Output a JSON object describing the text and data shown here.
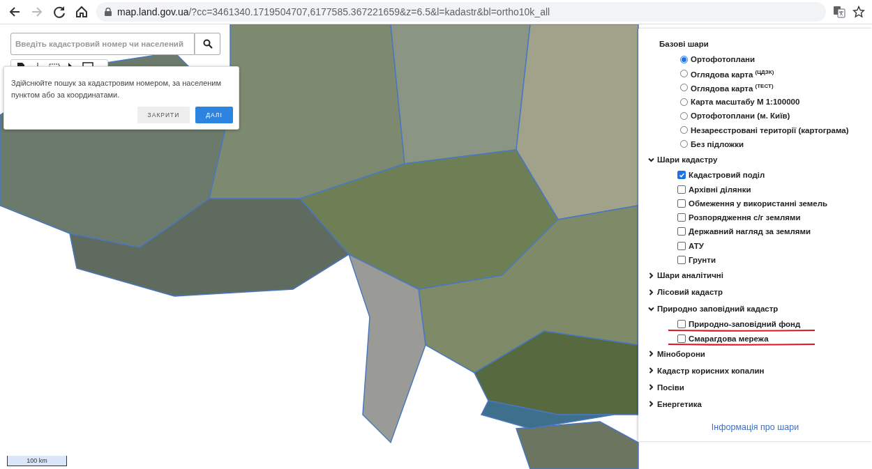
{
  "browser": {
    "url": "map.land.gov.ua/?cc=3461340.1719504707,6177585.367221659&z=6.5&l=kadastr&bl=ortho10k_all",
    "forward_disabled": true
  },
  "map": {
    "scale": "100 km"
  },
  "search": {
    "placeholder": "Введіть кадастровий номер чи населений"
  },
  "hint": {
    "text": "Здійснюйте пошук за кадастровим номером, за населеним пунктом або за координатами.",
    "buttons": [
      {
        "label": "ЗАКРИТИ",
        "kind": "secondary"
      },
      {
        "label": "ДАЛІ",
        "kind": "primary"
      }
    ]
  },
  "layers": {
    "sections": [
      {
        "title": "Базові шари",
        "kind": "base",
        "items": [
          {
            "kind": "radio",
            "label": "Ортофотоплани",
            "selected": true,
            "underlined": false
          },
          {
            "kind": "radio",
            "label": "Оглядова карта $^{(ЦДЗК)}$",
            "selected": false,
            "underlined": false
          },
          {
            "kind": "radio",
            "label": "Оглядова карта $^{(ТЕСТ)}$",
            "selected": false,
            "underlined": false
          },
          {
            "kind": "radio",
            "label": "Карта масштабу М 1:100000",
            "selected": false,
            "underlined": false
          },
          {
            "kind": "radio",
            "label": "Ортофотоплани (м. Київ)",
            "selected": false,
            "underlined": false
          },
          {
            "kind": "radio",
            "label": "Незареєстровані території (картограма)",
            "selected": false,
            "underlined": false
          },
          {
            "kind": "radio",
            "label": "Без підложки",
            "selected": false,
            "underlined": false
          }
        ]
      },
      {
        "title": "Шари кадастру",
        "kind": "group",
        "expanded": true,
        "items": [
          {
            "kind": "checkbox",
            "label": "Кадастровий поділ",
            "checked": true,
            "underlined": false
          },
          {
            "kind": "checkbox",
            "label": "Архівні ділянки",
            "checked": false,
            "underlined": false
          },
          {
            "kind": "checkbox",
            "label": "Обмеження у використанні земель",
            "checked": false,
            "underlined": false
          },
          {
            "kind": "checkbox",
            "label": "Розпорядження с/г землями",
            "checked": false,
            "underlined": false
          },
          {
            "kind": "checkbox",
            "label": "Державний нагляд за землями",
            "checked": false,
            "underlined": false
          },
          {
            "kind": "checkbox",
            "label": "АТУ",
            "checked": false,
            "underlined": false
          },
          {
            "kind": "checkbox",
            "label": "Грунти",
            "checked": false,
            "underlined": false
          }
        ]
      },
      {
        "title": "Шари аналітичні",
        "kind": "group",
        "expanded": false
      },
      {
        "title": "Лісовий кадастр",
        "kind": "group",
        "expanded": false
      },
      {
        "title": "Природно заповідний кадастр",
        "kind": "group",
        "expanded": true,
        "items": [
          {
            "kind": "checkbox",
            "label": "Природно-заповідний фонд",
            "checked": false,
            "underlined": true
          },
          {
            "kind": "checkbox",
            "label": "Смарагдова мережа",
            "checked": false,
            "underlined": true
          }
        ]
      },
      {
        "title": "Міноборони",
        "kind": "group",
        "expanded": false
      },
      {
        "title": "Кадастр корисних копалин",
        "kind": "group",
        "expanded": false
      },
      {
        "title": "Посіви",
        "kind": "group",
        "expanded": false
      },
      {
        "title": "Енергетика",
        "kind": "group",
        "expanded": false
      }
    ],
    "link": "Інформація про шари"
  }
}
